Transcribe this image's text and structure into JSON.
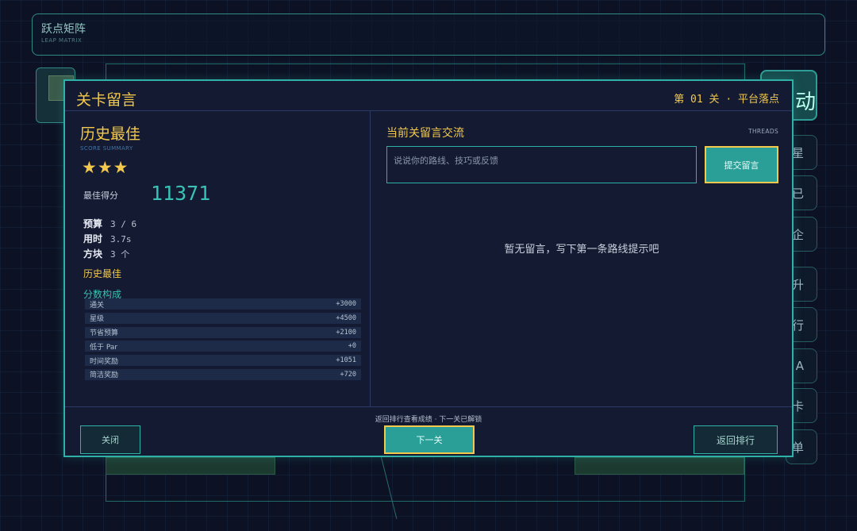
{
  "app": {
    "title": "跃点矩阵",
    "subtitle": "LEAP MATRIX"
  },
  "background": {
    "badge_glyph": "动",
    "side_buttons": [
      "星",
      "已",
      "企",
      "升",
      "行",
      "A",
      "卡",
      "单"
    ]
  },
  "modal": {
    "title": "关卡留言",
    "level_meta": "第 01 关 · 平台落点"
  },
  "summary": {
    "title": "历史最佳",
    "subtitle": "SCORE SUMMARY",
    "stars": "★★★",
    "star_count": 3,
    "best_label": "最佳得分",
    "best_score": "11371",
    "stats": [
      {
        "label": "预算",
        "value": "3 / 6"
      },
      {
        "label": "用时",
        "value": "3.7s"
      },
      {
        "label": "方块",
        "value": "3 个"
      }
    ],
    "history_tag": "历史最佳",
    "breakdown_title": "分数构成",
    "breakdown": [
      {
        "label": "通关",
        "value": "+3000"
      },
      {
        "label": "星级",
        "value": "+4500"
      },
      {
        "label": "节省预算",
        "value": "+2100"
      },
      {
        "label": "低于 Par",
        "value": "+0"
      },
      {
        "label": "时间奖励",
        "value": "+1051"
      },
      {
        "label": "简洁奖励",
        "value": "+720"
      }
    ]
  },
  "threads": {
    "title": "当前关留言交流",
    "tag": "THREADS",
    "input_placeholder": "说说你的路线、技巧或反馈",
    "input_value": "",
    "submit_label": "提交留言",
    "empty_message": "暂无留言，写下第一条路线提示吧"
  },
  "footer": {
    "note": "返回排行查看成绩 · 下一关已解锁",
    "close_label": "关闭",
    "next_label": "下一关",
    "back_label": "返回排行"
  },
  "colors": {
    "accent": "#2fb1a7",
    "gold": "#f2c94c",
    "panel": "#141a32",
    "background": "#0c1224"
  }
}
